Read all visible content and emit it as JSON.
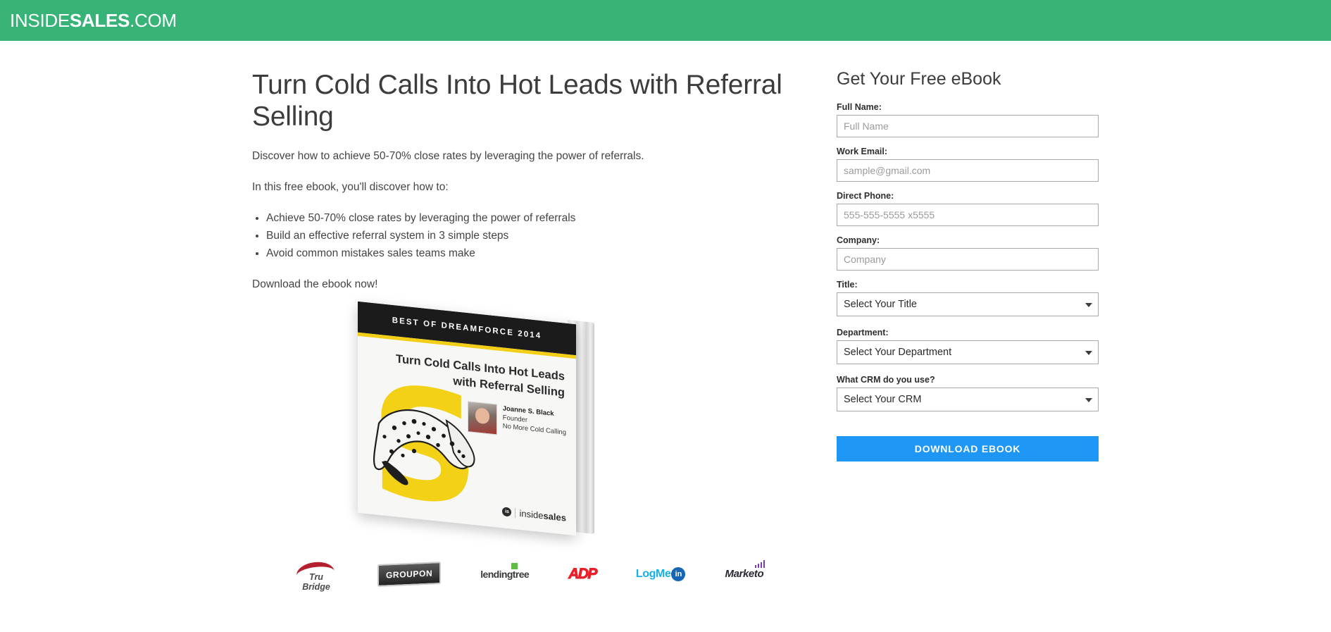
{
  "header": {
    "logo_part1": "INSIDE",
    "logo_part2": "SALES",
    "logo_part3": ".COM",
    "background_color": "#38b377"
  },
  "main": {
    "headline": "Turn Cold Calls Into Hot Leads with Referral Selling",
    "intro": "Discover how to achieve 50-70% close rates by leveraging the power of referrals.",
    "lead_in": "In this free ebook, you'll discover how to:",
    "bullets": [
      "Achieve 50-70% close rates by leveraging the power of referrals",
      "Build an effective referral system in 3 simple steps",
      "Avoid common mistakes sales teams make"
    ],
    "closing": "Download the ebook now!"
  },
  "book": {
    "band": "BEST OF DREAMFORCE 2014",
    "title_line1": "Turn Cold Calls Into Hot Leads",
    "title_line2": "with Referral Selling",
    "blob_letter": "S",
    "author_name": "Joanne S. Black",
    "author_role": "Founder",
    "author_company": "No More Cold Calling",
    "footer_mark": "is",
    "footer_word1": "inside",
    "footer_word2": "sales",
    "accent_yellow": "#f2cf16"
  },
  "partners": [
    {
      "name": "TruBridge",
      "label": "Tru Bridge",
      "color": "#b4202f"
    },
    {
      "name": "Groupon",
      "label": "GROUPON",
      "color": "#232323"
    },
    {
      "name": "LendingTree",
      "label": "lendingtree",
      "color": "#62bb46"
    },
    {
      "name": "ADP",
      "label": "ADP",
      "color": "#e8202a"
    },
    {
      "name": "LogMeIn",
      "label": "LogMe",
      "badge": "in",
      "color": "#17b0e8"
    },
    {
      "name": "Marketo",
      "label": "Marketo",
      "color": "#7b3fa0"
    }
  ],
  "form": {
    "title": "Get Your Free eBook",
    "fields": [
      {
        "label": "Full Name:",
        "placeholder": "Full Name",
        "value": ""
      },
      {
        "label": "Work Email:",
        "placeholder": "sample@gmail.com",
        "value": ""
      },
      {
        "label": "Direct Phone:",
        "placeholder": "555-555-5555 x5555",
        "value": ""
      },
      {
        "label": "Company:",
        "placeholder": "Company",
        "value": ""
      }
    ],
    "selects": [
      {
        "label": "Title:",
        "selected": "Select Your Title"
      },
      {
        "label": "Department:",
        "selected": "Select Your Department"
      },
      {
        "label": "What CRM do you use?",
        "selected": "Select Your CRM"
      }
    ],
    "submit_label": "DOWNLOAD EBOOK",
    "submit_color": "#1e96f5"
  }
}
